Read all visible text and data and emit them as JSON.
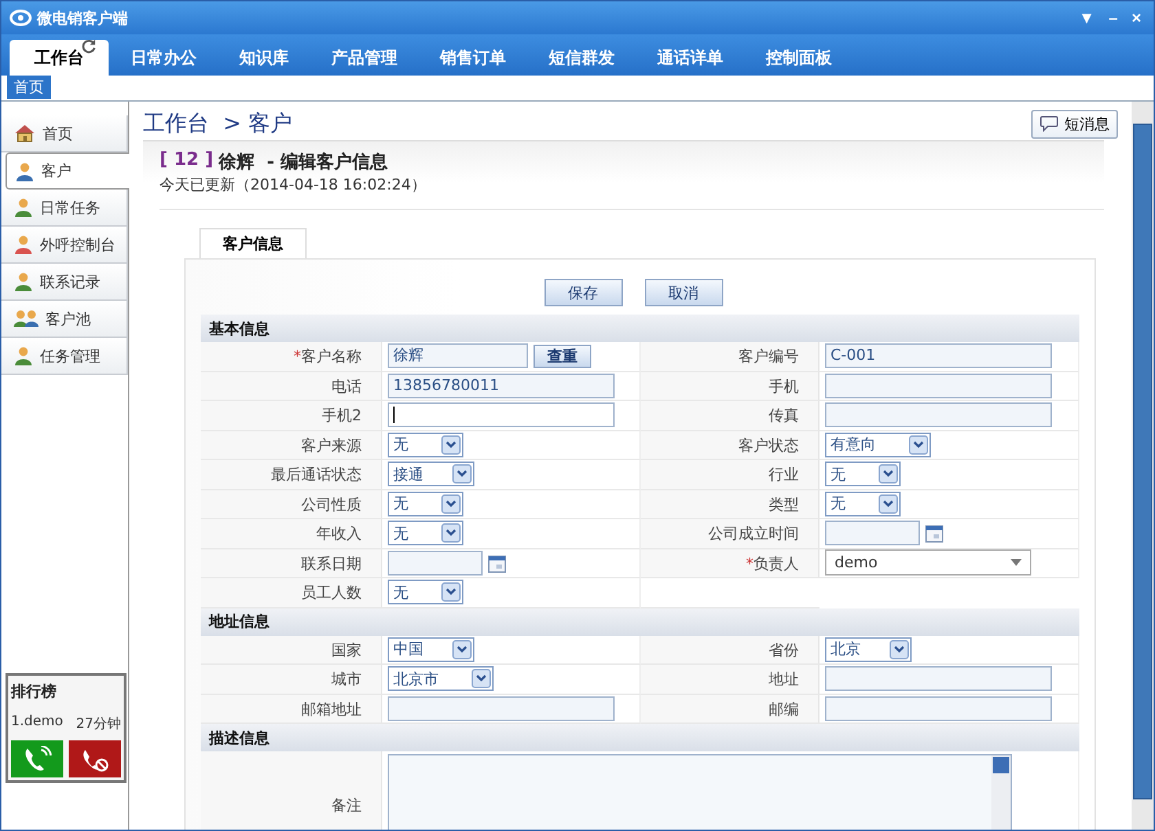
{
  "window": {
    "title": "微电销客户端",
    "controls": [
      "▼",
      "–",
      "×"
    ]
  },
  "tabs": [
    {
      "label": "工作台",
      "selected": true
    },
    {
      "label": "日常办公",
      "selected": false
    },
    {
      "label": "知识库",
      "selected": false
    },
    {
      "label": "产品管理",
      "selected": false
    },
    {
      "label": "销售订单",
      "selected": false
    },
    {
      "label": "短信群发",
      "selected": false
    },
    {
      "label": "通话详单",
      "selected": false
    },
    {
      "label": "控制面板",
      "selected": false
    }
  ],
  "page_tag": "首页",
  "sidebar": {
    "items": [
      {
        "label": "首页",
        "selected": false
      },
      {
        "label": "客户",
        "selected": true
      },
      {
        "label": "日常任务",
        "selected": false
      },
      {
        "label": "外呼控制台",
        "selected": false
      },
      {
        "label": "联系记录",
        "selected": false
      },
      {
        "label": "客户池",
        "selected": false
      },
      {
        "label": "任务管理",
        "selected": false
      }
    ]
  },
  "rank": {
    "title": "排行榜",
    "entries": [
      {
        "name": "1.demo",
        "time": "27分钟"
      }
    ]
  },
  "breadcrumb": "工作台  > 客户",
  "message_button": "短消息",
  "record": {
    "id": "[ 12 ]",
    "heading": "徐辉  - 编辑客户信息",
    "updated": "今天已更新（2014-04-18 16:02:24）"
  },
  "form_tabs": [
    {
      "label": "客户信息",
      "selected": true
    }
  ],
  "actions": [
    "保存",
    "取消"
  ],
  "sections": [
    {
      "title": "基本信息",
      "fields": [
        {
          "label": "客户名称",
          "required_mark": "*",
          "kind": "text-check",
          "value": "徐辉",
          "button": "查重"
        },
        {
          "label": "客户编号",
          "kind": "text",
          "value": "C-001"
        },
        {
          "label": "电话",
          "kind": "text",
          "value": "13856780011"
        },
        {
          "label": "手机",
          "kind": "text"
        },
        {
          "label": "手机2",
          "kind": "text",
          "focused": true
        },
        {
          "label": "传真",
          "kind": "text"
        },
        {
          "label": "客户来源",
          "kind": "select",
          "value": "无"
        },
        {
          "label": "客户状态",
          "kind": "select",
          "value": "有意向"
        },
        {
          "label": "最后通话状态",
          "kind": "select",
          "value": "接通"
        },
        {
          "label": "行业",
          "kind": "select",
          "value": "无"
        },
        {
          "label": "公司性质",
          "kind": "select",
          "value": "无"
        },
        {
          "label": "类型",
          "kind": "select",
          "value": "无"
        },
        {
          "label": "年收入",
          "kind": "select",
          "value": "无"
        },
        {
          "label": "公司成立时间",
          "kind": "date"
        },
        {
          "label": "联系日期",
          "kind": "date"
        },
        {
          "label": "负责人",
          "required_mark": "*",
          "kind": "combo",
          "value": "demo"
        },
        {
          "label": "员工人数",
          "kind": "select",
          "value": "无"
        }
      ]
    },
    {
      "title": "地址信息",
      "fields": [
        {
          "label": "国家",
          "kind": "select",
          "value": "中国"
        },
        {
          "label": "省份",
          "kind": "select",
          "value": "北京"
        },
        {
          "label": "城市",
          "kind": "select",
          "value": "北京市"
        },
        {
          "label": "地址",
          "kind": "text"
        },
        {
          "label": "邮箱地址",
          "kind": "text"
        },
        {
          "label": "邮编",
          "kind": "text"
        }
      ]
    },
    {
      "title": "描述信息",
      "fields": [
        {
          "label": "备注",
          "kind": "textarea"
        }
      ]
    }
  ]
}
